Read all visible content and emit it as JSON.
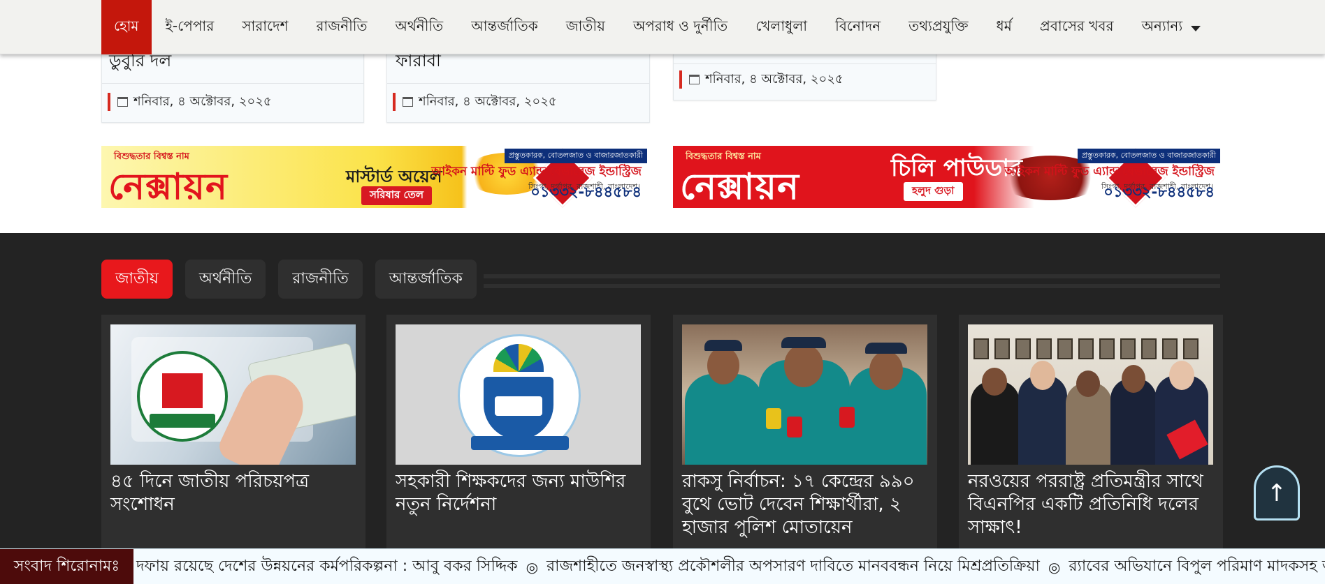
{
  "nav": {
    "items": [
      "হোম",
      "ই-পেপার",
      "সারাদেশ",
      "রাজনীতি",
      "অর্থনীতি",
      "আন্তর্জাতিক",
      "জাতীয়",
      "অপরাধ ও দুর্নীতি",
      "খেলাধুলা",
      "বিনোদন",
      "তথ্যপ্রযুক্তি",
      "ধর্ম",
      "প্রবাসের খবর"
    ],
    "more_label": "অন্যান্য",
    "icon": "chevron-down-icon",
    "active": "হোম"
  },
  "top_cards": [
    {
      "title_fragment": "ডুবুরি দল",
      "date": "শনিবার, ৪ অক্টোবর, ২০২৫"
    },
    {
      "title_fragment": "ফারাবী",
      "date": "শনিবার, ৪ অক্টোবর, ২০২৫"
    },
    {
      "title_fragment": "",
      "date": "শনিবার, ৪ অক্টোবর, ২০২৫"
    }
  ],
  "ads": [
    {
      "tagline": "বিশুদ্ধতার বিশ্বস্ত নাম",
      "brand": "নেক্সায়ন",
      "product": "মাস্টার্ড অয়েল",
      "subtitle": "সরিষার তেল",
      "company": "আইকন মাল্টি ফুড এ্যান্ড বেভারেজ ইন্ডাস্ট্রিজ",
      "address": "সিংগা, দুর্গাপুর, রাজশাহী, বাংলাদেশ।",
      "strip": "প্রস্তুতকারক, বোতলজাত ও বাজারজাতকারী",
      "phone": "০১৩৩২-৮৪৪৫৮৪"
    },
    {
      "tagline": "বিশুদ্ধতার বিশ্বস্ত নাম",
      "brand": "নেক্সায়ন",
      "product": "চিলি পাউডার",
      "subtitle": "হলুদ গুড়া",
      "company": "আইকন মাল্টি ফুড এ্যান্ড বেভারেজ ইন্ডাস্ট্রিজ",
      "address": "সিংগা, দুর্গাপুর, রাজশাহী, বাংলাদেশ।",
      "strip": "প্রস্তুতকারক, বোতলজাত ও বাজারজাতকারী",
      "phone": "০১৩৩২-৮৪৪৫৮৪"
    }
  ],
  "tabs": [
    "জাতীয়",
    "অর্থনীতি",
    "রাজনীতি",
    "আন্তর্জাতিক"
  ],
  "active_tab": "জাতীয়",
  "articles": [
    {
      "headline": "৪৫ দিনে জাতীয় পরিচয়পত্র সংশোধন",
      "image": "nid-card-photo"
    },
    {
      "headline": "সহকারী শিক্ষকদের জন্য মাউশির নতুন নির্দেশনা",
      "image": "mauhshi-logo"
    },
    {
      "headline": "রাকসু নির্বাচন: ১৭ কেন্দ্রের ৯৯০ বুথে ভোট দেবেন শিক্ষার্থীরা, ২ হাজার পুলিশ মোতায়েন",
      "image": "police-briefing-photo"
    },
    {
      "headline": "নরওয়ের পররাষ্ট্র প্রতিমন্ত্রীর সাথে বিএনপির একটি প্রতিনিধি দলের সাক্ষাৎ!",
      "image": "delegation-meeting-photo"
    }
  ],
  "scroll_top": {
    "icon": "arrow-up-icon",
    "glyph": "↑"
  },
  "ticker": {
    "label": "সংবাদ শিরোনামঃ",
    "items": [
      "দফায় রয়েছে দেশের উন্নয়নের কর্মপরিকল্পনা : আবু বকর সিদ্দিক",
      "রাজশাহীতে জনস্বাস্থ্য প্রকৌশলীর অপসারণ দাবিতে মানববন্ধন নিয়ে মিশ্রপ্রতিক্রিয়া",
      "র‍্যাবের অভিযানে বিপুল পরিমাণ মাদকসহ আটক"
    ],
    "separator": "◎"
  },
  "colors": {
    "accent_red": "#c4170c",
    "tab_active": "#e8181c",
    "dark_bg": "#232323",
    "ticker_label_bg": "#4d0b0b"
  }
}
